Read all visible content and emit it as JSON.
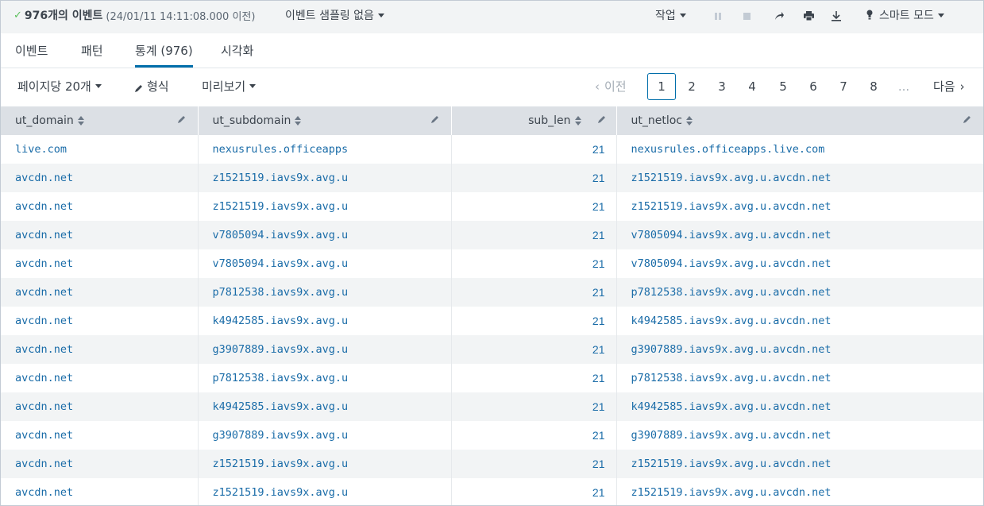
{
  "status": {
    "event_count": "976개의 이벤트",
    "range": "(24/01/11 14:11:08.000 이전)",
    "sampling": "이벤트 샘플링 없음",
    "job": "작업",
    "smart_mode": "스마트 모드"
  },
  "tabs": [
    {
      "label": "이벤트"
    },
    {
      "label": "패턴"
    },
    {
      "label": "통계 (976)"
    },
    {
      "label": "시각화"
    }
  ],
  "controls": {
    "per_page": "페이지당 20개",
    "format": "형식",
    "preview": "미리보기",
    "prev": "이전",
    "next": "다음",
    "pages": [
      "1",
      "2",
      "3",
      "4",
      "5",
      "6",
      "7",
      "8"
    ],
    "ellipsis": "...",
    "current_page": "1"
  },
  "table": {
    "columns": [
      "ut_domain",
      "ut_subdomain",
      "sub_len",
      "ut_netloc"
    ],
    "rows": [
      [
        "live.com",
        "nexusrules.officeapps",
        "21",
        "nexusrules.officeapps.live.com"
      ],
      [
        "avcdn.net",
        "z1521519.iavs9x.avg.u",
        "21",
        "z1521519.iavs9x.avg.u.avcdn.net"
      ],
      [
        "avcdn.net",
        "z1521519.iavs9x.avg.u",
        "21",
        "z1521519.iavs9x.avg.u.avcdn.net"
      ],
      [
        "avcdn.net",
        "v7805094.iavs9x.avg.u",
        "21",
        "v7805094.iavs9x.avg.u.avcdn.net"
      ],
      [
        "avcdn.net",
        "v7805094.iavs9x.avg.u",
        "21",
        "v7805094.iavs9x.avg.u.avcdn.net"
      ],
      [
        "avcdn.net",
        "p7812538.iavs9x.avg.u",
        "21",
        "p7812538.iavs9x.avg.u.avcdn.net"
      ],
      [
        "avcdn.net",
        "k4942585.iavs9x.avg.u",
        "21",
        "k4942585.iavs9x.avg.u.avcdn.net"
      ],
      [
        "avcdn.net",
        "g3907889.iavs9x.avg.u",
        "21",
        "g3907889.iavs9x.avg.u.avcdn.net"
      ],
      [
        "avcdn.net",
        "p7812538.iavs9x.avg.u",
        "21",
        "p7812538.iavs9x.avg.u.avcdn.net"
      ],
      [
        "avcdn.net",
        "k4942585.iavs9x.avg.u",
        "21",
        "k4942585.iavs9x.avg.u.avcdn.net"
      ],
      [
        "avcdn.net",
        "g3907889.iavs9x.avg.u",
        "21",
        "g3907889.iavs9x.avg.u.avcdn.net"
      ],
      [
        "avcdn.net",
        "z1521519.iavs9x.avg.u",
        "21",
        "z1521519.iavs9x.avg.u.avcdn.net"
      ],
      [
        "avcdn.net",
        "z1521519.iavs9x.avg.u",
        "21",
        "z1521519.iavs9x.avg.u.avcdn.net"
      ]
    ]
  },
  "colors": {
    "accent": "#006eaa",
    "link": "#1a6ca8",
    "success": "#5cc05c",
    "header_bg": "#dce0e5",
    "stripe": "#f2f4f5"
  },
  "icons": [
    "check-icon",
    "pause-icon",
    "stop-icon",
    "share-icon",
    "print-icon",
    "export-icon",
    "bulb-icon",
    "pencil-icon",
    "sort-icon",
    "chevron-left-icon",
    "chevron-right-icon"
  ]
}
